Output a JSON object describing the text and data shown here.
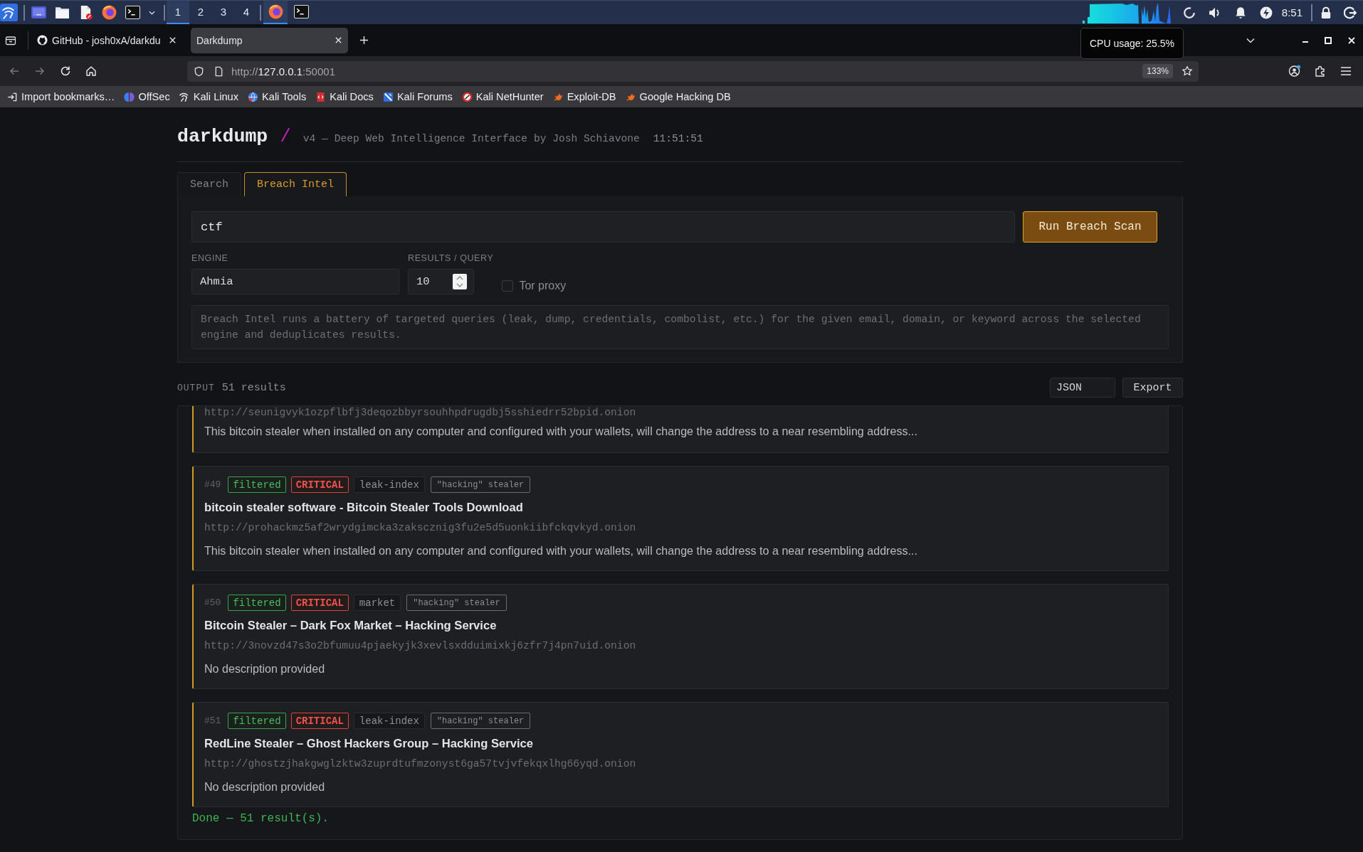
{
  "taskbar": {
    "workspaces": [
      {
        "label": "1",
        "selected": true
      },
      {
        "label": "2",
        "selected": false
      },
      {
        "label": "3",
        "selected": false
      },
      {
        "label": "4",
        "selected": false
      }
    ],
    "windows": [
      {
        "kind": "browser",
        "selected": true
      },
      {
        "kind": "terminal",
        "selected": false
      }
    ],
    "clock": "8:51"
  },
  "tooltip": {
    "text": "CPU usage: 25.5%"
  },
  "browser": {
    "tabs": [
      {
        "title": "GitHub - josh0xA/darkdu",
        "favicon": true,
        "selected": false
      },
      {
        "title": "Darkdump",
        "favicon": false,
        "selected": true
      }
    ],
    "back_disabled": true,
    "forward_disabled": true,
    "address": {
      "scheme": "http://",
      "host": "127.0.0.1",
      "port": ":50001"
    },
    "zoom": "133%",
    "bookmarks": [
      {
        "label": "Import bookmarks…",
        "kind": "import"
      },
      {
        "label": "OffSec",
        "kind": "offsec"
      },
      {
        "label": "Kali Linux",
        "kind": "dragon"
      },
      {
        "label": "Kali Tools",
        "kind": "tools"
      },
      {
        "label": "Kali Docs",
        "kind": "docs"
      },
      {
        "label": "Kali Forums",
        "kind": "forums"
      },
      {
        "label": "Kali NetHunter",
        "kind": "nethunter"
      },
      {
        "label": "Exploit-DB",
        "kind": "exploit"
      },
      {
        "label": "Google Hacking DB",
        "kind": "exploit"
      }
    ]
  },
  "app": {
    "title": "darkdump",
    "separator": "/",
    "subtitle": "v4 — Deep Web Intelligence Interface by Josh Schiavone",
    "time": "11:51:51"
  },
  "tabs": [
    {
      "label": "Search",
      "selected": false
    },
    {
      "label": "Breach Intel",
      "selected": true
    }
  ],
  "form": {
    "query": "ctf",
    "run_button": "Run Breach Scan",
    "engine": {
      "label": "ENGINE",
      "value": "Ahmia"
    },
    "results_per_query": {
      "label": "RESULTS / QUERY",
      "value": "10"
    },
    "tor_proxy": {
      "label": "Tor proxy",
      "checked": false
    },
    "info": "Breach Intel runs a battery of targeted queries (leak, dump, credentials, combolist, etc.) for the given email, domain, or keyword across the selected engine and deduplicates results."
  },
  "output": {
    "label": "OUTPUT",
    "count": "51 results",
    "format": "JSON",
    "export": "Export",
    "results": [
      {
        "url": "http://seunigvyk1ozpflbfj3deqozbbyrsouhhpdrugdbj5sshiedrr52bpid.onion",
        "description": "This bitcoin stealer when installed on any computer and configured with your wallets, will change the address to a near resembling address..."
      },
      {
        "number": "#49",
        "tags": [
          {
            "label": "filtered",
            "kind": "status"
          },
          {
            "label": "CRITICAL",
            "kind": "severity"
          },
          {
            "label": "leak-index",
            "kind": "source"
          },
          {
            "label": "\"hacking\" stealer",
            "kind": "query"
          }
        ],
        "title": "bitcoin stealer software - Bitcoin Stealer Tools Download",
        "url": "http://prohackmz5af2wrydgimcka3zakscznig3fu2e5d5uonkiibfckqvkyd.onion",
        "description": "This bitcoin stealer when installed on any computer and configured with your wallets, will change the address to a near resembling address..."
      },
      {
        "number": "#50",
        "tags": [
          {
            "label": "filtered",
            "kind": "status"
          },
          {
            "label": "CRITICAL",
            "kind": "severity"
          },
          {
            "label": "market",
            "kind": "source"
          },
          {
            "label": "\"hacking\" stealer",
            "kind": "query"
          }
        ],
        "title": "Bitcoin Stealer – Dark Fox Market – Hacking Service",
        "url": "http://3novzd47s3o2bfumuu4pjaekyjk3xevlsxdduimixkj6zfr7j4pn7uid.onion",
        "description": "No description provided"
      },
      {
        "number": "#51",
        "tags": [
          {
            "label": "filtered",
            "kind": "status"
          },
          {
            "label": "CRITICAL",
            "kind": "severity"
          },
          {
            "label": "leak-index",
            "kind": "source"
          },
          {
            "label": "\"hacking\" stealer",
            "kind": "query"
          }
        ],
        "title": "RedLine Stealer – Ghost Hackers Group – Hacking Service",
        "url": "http://ghostzjhakgwglzktw3zuprdtufmzonyst6ga57tvjvfekqxlhg66yqd.onion",
        "description": "No description provided"
      }
    ],
    "status": "Done — 51 result(s)."
  }
}
